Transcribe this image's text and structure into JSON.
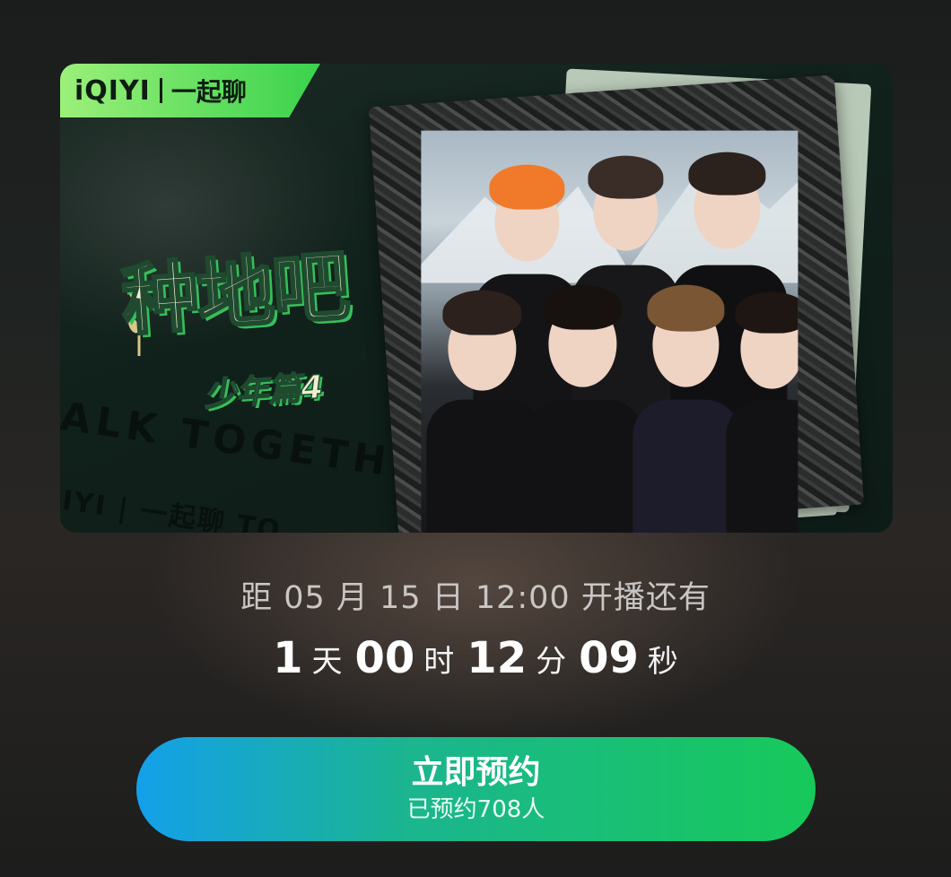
{
  "poster": {
    "brand_logo": "iQIYI",
    "brand_name": "一起聊",
    "show_title": "种地吧",
    "show_subtitle": "少年篇4",
    "bg_text_1": "ALK TOGETHE",
    "bg_text_2": "IYI | 一起聊  TO"
  },
  "countdown": {
    "label": "距 05 月 15 日 12:00 开播还有",
    "days": "1",
    "days_unit": "天",
    "hours": "00",
    "hours_unit": "时",
    "minutes": "12",
    "minutes_unit": "分",
    "seconds": "09",
    "seconds_unit": "秒"
  },
  "reserve": {
    "label": "立即预约",
    "count_text": "已预约708人"
  },
  "colors": {
    "button_start": "#14a0ea",
    "button_end": "#17c95a",
    "brand_green": "#39d24c"
  }
}
